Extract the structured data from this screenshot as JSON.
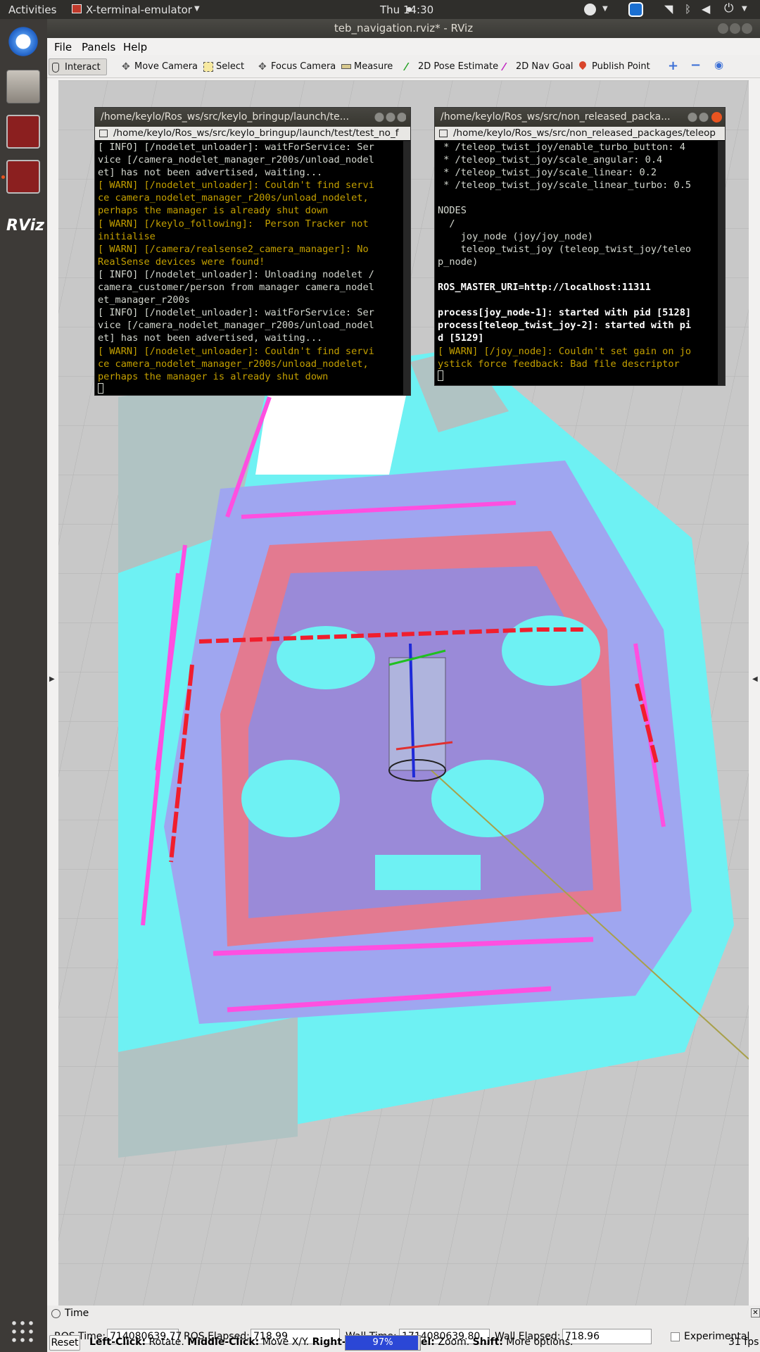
{
  "topbar": {
    "activities": "Activities",
    "app": "X-terminal-emulator",
    "clock": "Thu 14:30"
  },
  "window": {
    "title": "teb_navigation.rviz* - RViz"
  },
  "menu": [
    "File",
    "Panels",
    "Help"
  ],
  "toolbar": [
    {
      "label": "Interact",
      "icon": "hand-pointer-icon"
    },
    {
      "label": "Move Camera",
      "icon": "move-camera-icon"
    },
    {
      "label": "Select",
      "icon": "select-box-icon"
    },
    {
      "label": "Focus Camera",
      "icon": "focus-camera-icon"
    },
    {
      "label": "Measure",
      "icon": "ruler-icon"
    },
    {
      "label": "2D Pose Estimate",
      "icon": "pose-arrow-icon"
    },
    {
      "label": "2D Nav Goal",
      "icon": "nav-goal-icon"
    },
    {
      "label": "Publish Point",
      "icon": "map-pin-icon"
    }
  ],
  "terminal1": {
    "title": "/home/keylo/Ros_ws/src/keylo_bringup/launch/te...",
    "tab": "/home/keylo/Ros_ws/src/keylo_bringup/launch/test/test_no_f",
    "lines": [
      {
        "t": "[ INFO] [/nodelet_unloader]: waitForService: Ser",
        "c": ""
      },
      {
        "t": "vice [/camera_nodelet_manager_r200s/unload_nodel",
        "c": ""
      },
      {
        "t": "et] has not been advertised, waiting...",
        "c": ""
      },
      {
        "t": "[ WARN] [/nodelet_unloader]: Couldn't find servi",
        "c": "warn"
      },
      {
        "t": "ce camera_nodelet_manager_r200s/unload_nodelet,",
        "c": "warn"
      },
      {
        "t": "perhaps the manager is already shut down",
        "c": "warn"
      },
      {
        "t": "[ WARN] [/keylo_following]:  Person Tracker not",
        "c": "warn"
      },
      {
        "t": "initialise",
        "c": "warn"
      },
      {
        "t": "[ WARN] [/camera/realsense2_camera_manager]: No",
        "c": "warn"
      },
      {
        "t": "RealSense devices were found!",
        "c": "warn"
      },
      {
        "t": "[ INFO] [/nodelet_unloader]: Unloading nodelet /",
        "c": ""
      },
      {
        "t": "camera_customer/person from manager camera_nodel",
        "c": ""
      },
      {
        "t": "et_manager_r200s",
        "c": ""
      },
      {
        "t": "[ INFO] [/nodelet_unloader]: waitForService: Ser",
        "c": ""
      },
      {
        "t": "vice [/camera_nodelet_manager_r200s/unload_nodel",
        "c": ""
      },
      {
        "t": "et] has not been advertised, waiting...",
        "c": ""
      },
      {
        "t": "[ WARN] [/nodelet_unloader]: Couldn't find servi",
        "c": "warn"
      },
      {
        "t": "ce camera_nodelet_manager_r200s/unload_nodelet,",
        "c": "warn"
      },
      {
        "t": "perhaps the manager is already shut down",
        "c": "warn"
      }
    ]
  },
  "terminal2": {
    "title": "/home/keylo/Ros_ws/src/non_released_packa...",
    "tab": "/home/keylo/Ros_ws/src/non_released_packages/teleop",
    "lines": [
      {
        "t": " * /teleop_twist_joy/enable_turbo_button: 4",
        "c": ""
      },
      {
        "t": " * /teleop_twist_joy/scale_angular: 0.4",
        "c": ""
      },
      {
        "t": " * /teleop_twist_joy/scale_linear: 0.2",
        "c": ""
      },
      {
        "t": " * /teleop_twist_joy/scale_linear_turbo: 0.5",
        "c": ""
      },
      {
        "t": "",
        "c": ""
      },
      {
        "t": "NODES",
        "c": ""
      },
      {
        "t": "  /",
        "c": ""
      },
      {
        "t": "    joy_node (joy/joy_node)",
        "c": ""
      },
      {
        "t": "    teleop_twist_joy (teleop_twist_joy/teleo",
        "c": ""
      },
      {
        "t": "p_node)",
        "c": ""
      },
      {
        "t": "",
        "c": ""
      },
      {
        "t": "ROS_MASTER_URI=http://localhost:11311",
        "c": "bold"
      },
      {
        "t": "",
        "c": ""
      },
      {
        "t": "process[joy_node-1]: started with pid [5128]",
        "c": "bold"
      },
      {
        "t": "process[teleop_twist_joy-2]: started with pi",
        "c": "bold"
      },
      {
        "t": "d [5129]",
        "c": "bold"
      },
      {
        "t": "[ WARN] [/joy_node]: Couldn't set gain on jo",
        "c": "warn"
      },
      {
        "t": "ystick force feedback: Bad file descriptor",
        "c": "warn"
      }
    ]
  },
  "time": {
    "panel_title": "Time",
    "ros_time_label": "ROS Time:",
    "ros_time": "714080639.77",
    "ros_elapsed_label": "ROS Elapsed:",
    "ros_elapsed": "718.99",
    "wall_time_label": "Wall Time:",
    "wall_time": "1714080639.80",
    "wall_elapsed_label": "Wall Elapsed:",
    "wall_elapsed": "718.96",
    "experimental": "Experimental"
  },
  "status": {
    "reset": "Reset",
    "hint_a": "Left-Click:",
    "hint_a2": " Rotate. ",
    "hint_b": "Middle-Click:",
    "hint_b2": " Move X/Y. ",
    "hint_c": "Right-Cli",
    "progress": "97%",
    "progress_value": 0.97,
    "hint_d": "el:",
    "hint_d2": " Zoom. ",
    "hint_e": "Shift:",
    "hint_e2": " More options.",
    "fps": "31 fps"
  }
}
